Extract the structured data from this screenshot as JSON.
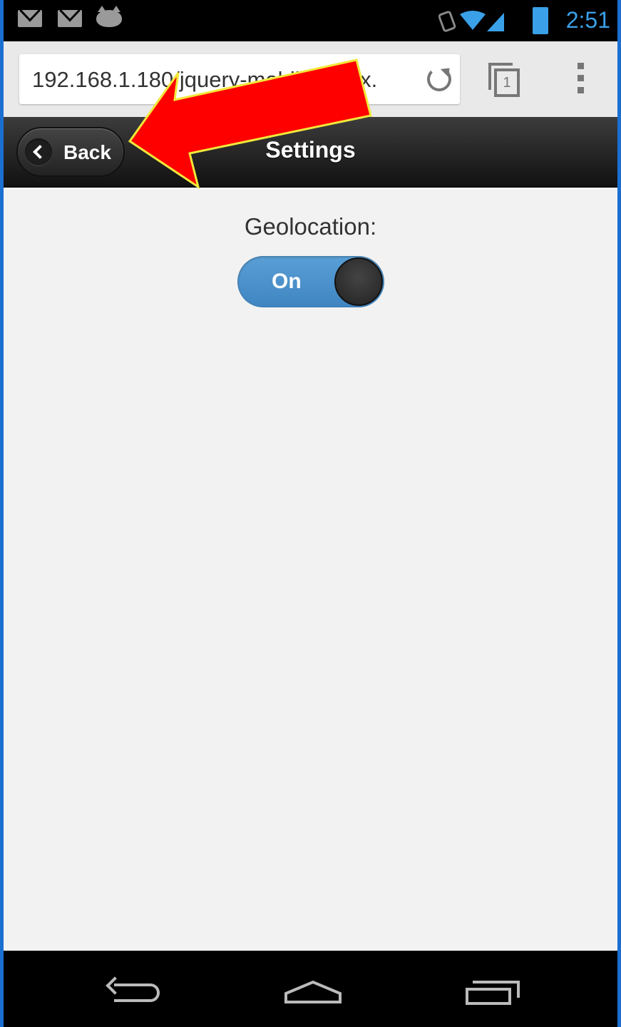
{
  "status_bar": {
    "time": "2:51",
    "icons": [
      "gmail-icon",
      "mail-icon",
      "cat-app-icon",
      "rotate-lock-icon",
      "wifi-icon",
      "signal-icon",
      "battery-icon"
    ]
  },
  "browser": {
    "url": "192.168.1.180/jquery-mobile/index.",
    "tab_count": "1"
  },
  "header": {
    "back_label": "Back",
    "title": "Settings"
  },
  "content": {
    "geolocation_label": "Geolocation:",
    "switch_label": "On",
    "switch_on": true
  },
  "colors": {
    "accent": "#3aa0e8",
    "switch": "#4a90cc",
    "annotation_arrow": "#ff0000",
    "annotation_outline": "#f2e83a",
    "frame": "#1a6fd0"
  },
  "nav_bar": {
    "icons": [
      "back-icon",
      "home-icon",
      "recent-apps-icon"
    ]
  }
}
